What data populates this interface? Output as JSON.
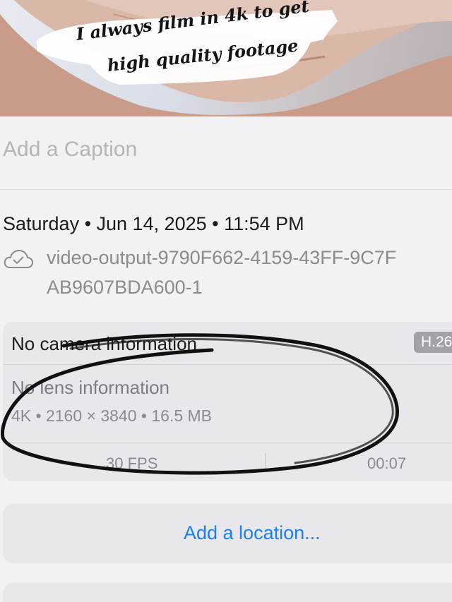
{
  "photo": {
    "overlay_line1": "I always film in 4k to get",
    "overlay_line2": "high quality footage"
  },
  "caption": {
    "placeholder": "Add a Caption"
  },
  "date": {
    "text": "Saturday • Jun 14, 2025 • 11:54 PM"
  },
  "file": {
    "icon": "cloud-check-icon",
    "name_line1": "video-output-9790F662-4159-43FF-9C7F",
    "name_line2": "AB9607BDA600-1"
  },
  "info": {
    "camera": "No camera information",
    "codec": "H.26",
    "lens": "No lens information",
    "specs": "4K • 2160 × 3840 • 16.5 MB",
    "fps": "30 FPS",
    "duration": "00:07"
  },
  "location": {
    "label": "Add a location..."
  },
  "colors": {
    "background": "#f2f2f4",
    "card": "#e8e8ec",
    "link_blue": "#1a7ef5",
    "scribble": "#111111"
  }
}
